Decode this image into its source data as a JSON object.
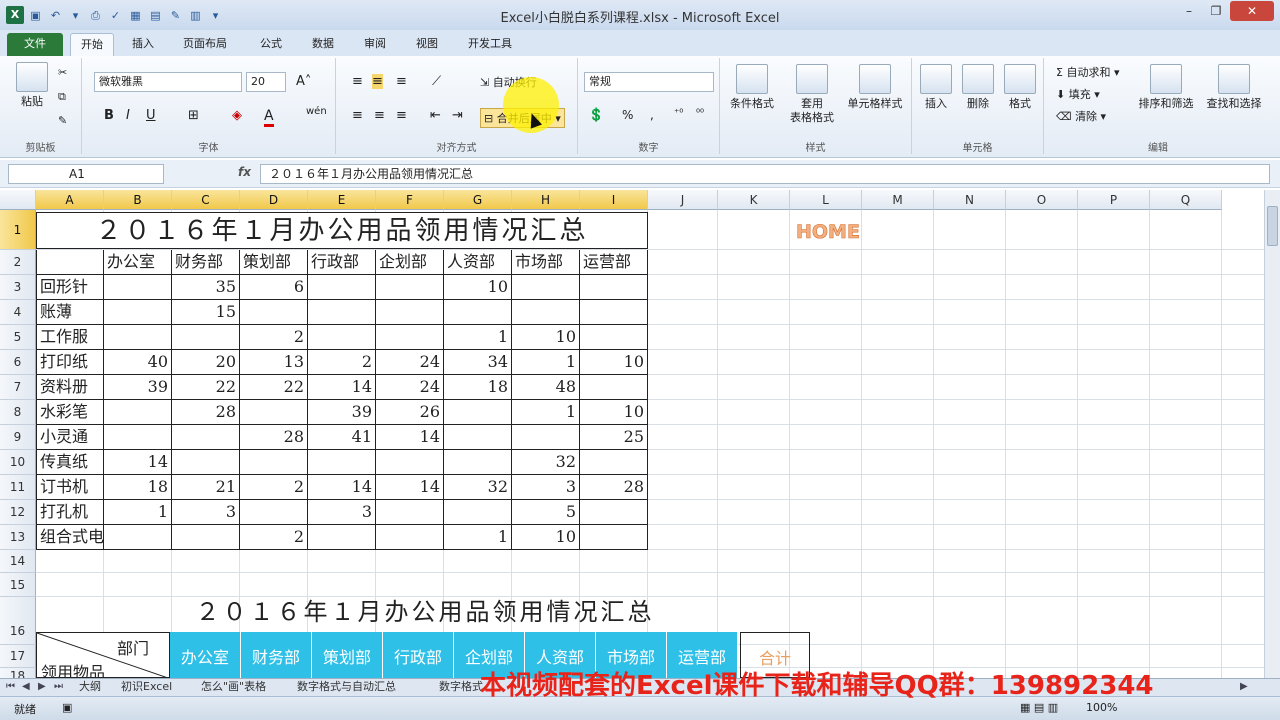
{
  "window": {
    "title": "Excel小白脱白系列课程.xlsx - Microsoft Excel",
    "close": "✕",
    "min": "–",
    "max": "❐"
  },
  "tabs": [
    {
      "label": "文件"
    },
    {
      "label": "开始"
    },
    {
      "label": "插入"
    },
    {
      "label": "页面布局"
    },
    {
      "label": "公式"
    },
    {
      "label": "数据"
    },
    {
      "label": "审阅"
    },
    {
      "label": "视图"
    },
    {
      "label": "开发工具"
    }
  ],
  "ribbon": {
    "clipboard": {
      "label": "剪贴板",
      "paste": "粘贴"
    },
    "font": {
      "label": "字体",
      "name": "微软雅黑",
      "size": "20",
      "bold": "B",
      "italic": "I",
      "underline": "U",
      "wen": "wén"
    },
    "alignment": {
      "label": "对齐方式",
      "wrap": "自动换行",
      "merge": "合并后居中"
    },
    "number": {
      "label": "数字",
      "format": "常规",
      "percent": "%",
      "comma": ","
    },
    "styles": {
      "label": "样式",
      "cond": "条件格式",
      "table": "套用",
      "table2": "表格格式",
      "cell": "单元格样式"
    },
    "cells": {
      "label": "单元格",
      "insert": "插入",
      "delete": "删除",
      "format": "格式"
    },
    "editing": {
      "label": "编辑",
      "autosum": "自动求和",
      "fill": "填充",
      "clear": "清除",
      "sort": "排序和筛选",
      "find": "查找和选择"
    }
  },
  "formula": {
    "namebox": "A1",
    "fx": "fx",
    "content": "２０１６年１月办公用品领用情况汇总"
  },
  "columns": [
    "A",
    "B",
    "C",
    "D",
    "E",
    "F",
    "G",
    "H",
    "I",
    "J",
    "K",
    "L",
    "M",
    "N",
    "O",
    "P",
    "Q"
  ],
  "rows": [
    "1",
    "2",
    "3",
    "4",
    "5",
    "6",
    "7",
    "8",
    "9",
    "10",
    "11",
    "12",
    "13",
    "14",
    "15",
    "16",
    "17",
    "18"
  ],
  "sheet": {
    "title": "２０１６年１月办公用品领用情况汇总",
    "home": "HOME",
    "headers": [
      "办公室",
      "财务部",
      "策划部",
      "行政部",
      "企划部",
      "人资部",
      "市场部",
      "运营部"
    ],
    "data": [
      {
        "item": "回形针",
        "v": [
          "",
          "35",
          "6",
          "",
          "",
          "10",
          "",
          ""
        ]
      },
      {
        "item": "账薄",
        "v": [
          "",
          "15",
          "",
          "",
          "",
          "",
          "",
          ""
        ]
      },
      {
        "item": "工作服",
        "v": [
          "",
          "",
          "2",
          "",
          "",
          "1",
          "10",
          ""
        ]
      },
      {
        "item": "打印纸",
        "v": [
          "40",
          "20",
          "13",
          "2",
          "24",
          "34",
          "1",
          "10"
        ]
      },
      {
        "item": "资料册",
        "v": [
          "39",
          "22",
          "22",
          "14",
          "24",
          "18",
          "48",
          ""
        ]
      },
      {
        "item": "水彩笔",
        "v": [
          "",
          "28",
          "",
          "39",
          "26",
          "",
          "1",
          "10"
        ]
      },
      {
        "item": "小灵通",
        "v": [
          "",
          "",
          "28",
          "41",
          "14",
          "",
          "",
          "25"
        ]
      },
      {
        "item": "传真纸",
        "v": [
          "14",
          "",
          "",
          "",
          "",
          "",
          "32",
          ""
        ]
      },
      {
        "item": "订书机",
        "v": [
          "18",
          "21",
          "2",
          "14",
          "14",
          "32",
          "3",
          "28"
        ]
      },
      {
        "item": "打孔机",
        "v": [
          "1",
          "3",
          "",
          "3",
          "",
          "",
          "5",
          ""
        ]
      },
      {
        "item": "组合式电脑桌",
        "v": [
          "",
          "",
          "2",
          "",
          "",
          "1",
          "10",
          ""
        ]
      }
    ],
    "title2": "２０１６年１月办公用品领用情况汇总",
    "corner_top": "部门",
    "corner_bottom": "领用物品",
    "headers2": [
      "办公室",
      "财务部",
      "策划部",
      "行政部",
      "企划部",
      "人资部",
      "市场部",
      "运营部"
    ],
    "total": "合计"
  },
  "sheet_tabs": [
    "大纲",
    "初识Excel",
    "怎么\"画\"表格",
    "数字格式与自动汇总",
    "数字格式"
  ],
  "status": {
    "ready": "就绪",
    "zoom": "100%"
  },
  "overlay": "本视频配套的Excel课件下载和辅导QQ群：139892344",
  "colors": {
    "accent": "#2b7a3a",
    "header_sel": "#f1c84a",
    "cyan": "#2fc0e8",
    "overlay": "#e8241a"
  }
}
